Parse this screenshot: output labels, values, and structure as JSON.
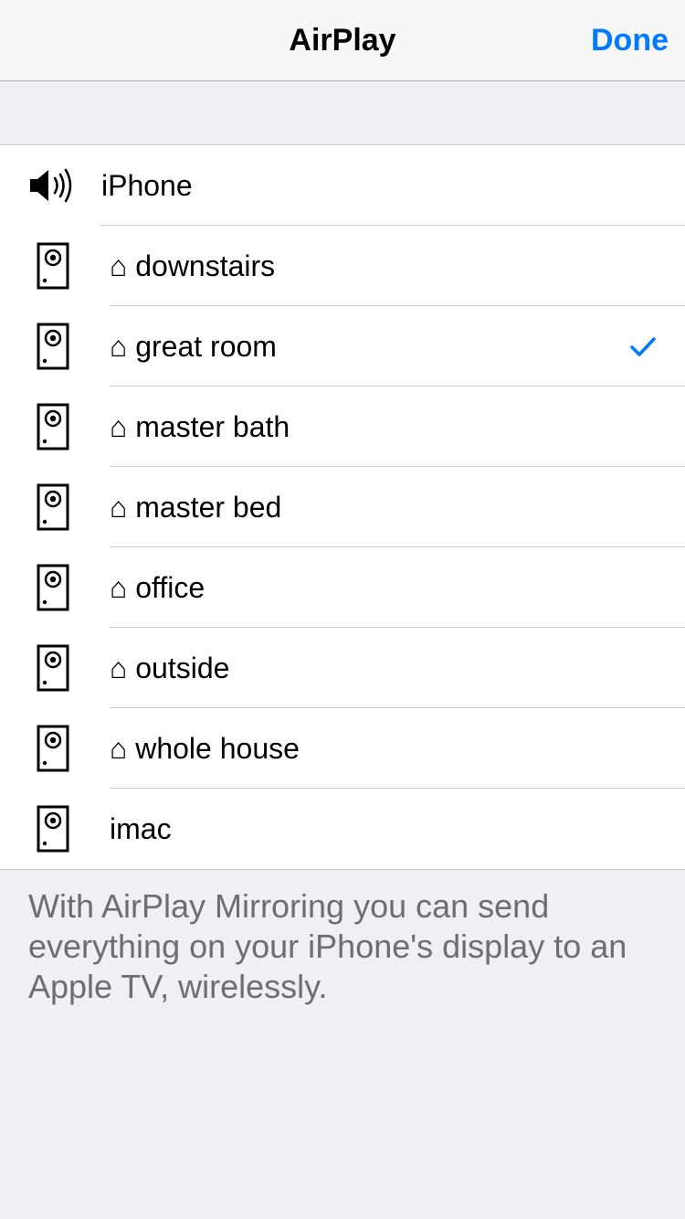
{
  "navbar": {
    "title": "AirPlay",
    "done_label": "Done",
    "accent_color": "#007aff"
  },
  "devices": [
    {
      "label": "iPhone",
      "icon": "speaker-volume-icon",
      "selected": false
    },
    {
      "label": "⌂ downstairs",
      "icon": "airport-express-icon",
      "selected": false
    },
    {
      "label": "⌂ great room",
      "icon": "airport-express-icon",
      "selected": true
    },
    {
      "label": "⌂ master bath",
      "icon": "airport-express-icon",
      "selected": false
    },
    {
      "label": "⌂ master bed",
      "icon": "airport-express-icon",
      "selected": false
    },
    {
      "label": "⌂ office",
      "icon": "airport-express-icon",
      "selected": false
    },
    {
      "label": "⌂ outside",
      "icon": "airport-express-icon",
      "selected": false
    },
    {
      "label": "⌂ whole house",
      "icon": "airport-express-icon",
      "selected": false
    },
    {
      "label": "imac",
      "icon": "airport-express-icon",
      "selected": false
    }
  ],
  "footer": {
    "text": "With AirPlay Mirroring you can send everything on your iPhone's display to an Apple TV, wirelessly."
  }
}
